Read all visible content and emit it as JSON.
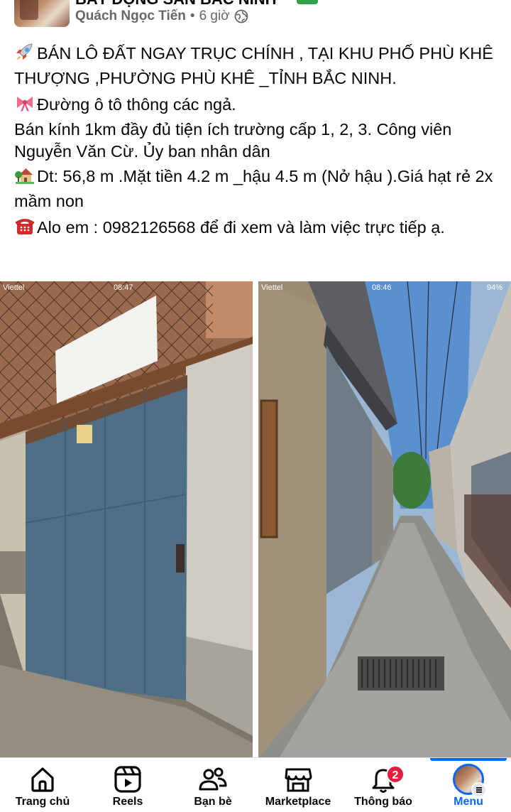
{
  "post": {
    "group_name": "BẤT ĐỘNG SẢN BẮC NINH",
    "author": "Quách Ngọc Tiến",
    "separator": "•",
    "time": "6 giờ",
    "privacy_icon": "globe-icon",
    "paragraphs": [
      {
        "icon": "rocket-icon",
        "text": "BÁN LÔ ĐẤT NGAY TRỤC CHÍNH  , TẠI KHU PHỐ PHÙ KHÊ THƯỢNG ,PHƯỜNG PHÙ KHÊ _TỈNH BẮC NINH."
      },
      {
        "icon": "ribbon-icon",
        "text": "Đường  ô tô thông các ngả."
      },
      {
        "icon": "",
        "text": "Bán kính 1km đầy đủ tiện ích trường cấp 1, 2, 3. Công viên Nguyễn Văn Cừ. Ủy ban nhân dân"
      },
      {
        "icon": "house-garden-icon",
        "text": "Dt: 56,8 m .Mặt tiền 4.2 m _hậu 4.5 m (Nở hậu ).Giá hạt rẻ 2x mầm non"
      },
      {
        "icon": "telephone-icon",
        "text": "Alo em  : 0982126568 để đi xem  và làm việc trực tiếp ạ."
      }
    ]
  },
  "photos": [
    {
      "name": "photo-gate",
      "status": {
        "carrier": "Viettel",
        "time": "08:47",
        "battery": ""
      }
    },
    {
      "name": "photo-alley",
      "status": {
        "carrier": "Viettel",
        "time": "08:46",
        "battery": "94%"
      }
    }
  ],
  "bottom_nav": [
    {
      "label": "Trang chủ",
      "icon": "home-icon",
      "active": false
    },
    {
      "label": "Reels",
      "icon": "reels-icon",
      "active": false
    },
    {
      "label": "Bạn bè",
      "icon": "friends-icon",
      "active": false
    },
    {
      "label": "Marketplace",
      "icon": "marketplace-icon",
      "active": false
    },
    {
      "label": "Thông báo",
      "icon": "bell-icon",
      "active": false,
      "badge": "2"
    },
    {
      "label": "Menu",
      "icon": "menu-avatar-icon",
      "active": true
    }
  ],
  "colors": {
    "accent": "#0866ff",
    "badge": "#e41e3f",
    "muted_text": "#65676b"
  }
}
